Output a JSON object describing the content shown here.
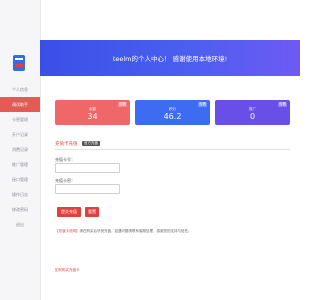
{
  "sidebar": {
    "items": [
      {
        "label": "个人信息",
        "active": false
      },
      {
        "label": "调试助手",
        "active": true
      },
      {
        "label": "卡密管理",
        "active": false
      },
      {
        "label": "开户记录",
        "active": false
      },
      {
        "label": "消费记录",
        "active": false
      },
      {
        "label": "推广管理",
        "active": false
      },
      {
        "label": "接口管理",
        "active": false
      },
      {
        "label": "操作日志",
        "active": false
      },
      {
        "label": "修改密码",
        "active": false
      },
      {
        "label": "退出",
        "active": false
      }
    ]
  },
  "banner": {
    "title": "teelm的个人中心！ 感谢使用本地环境!"
  },
  "cards": [
    {
      "badge": "查看",
      "label": "余额",
      "value": "34",
      "color": "#f0676a"
    },
    {
      "badge": "查看",
      "label": "积分",
      "value": "46.2",
      "color": "#3d6cf3"
    },
    {
      "badge": "查看",
      "label": "推广",
      "value": "0",
      "color": "#6a4ee8"
    }
  ],
  "section": {
    "title": "充值卡充值",
    "tag": "官方充值"
  },
  "form": {
    "field1_label": "充值卡号：",
    "field1_value": "",
    "field2_label": "充值卡密：",
    "field2_value": ""
  },
  "buttons": {
    "primary": "提交充值卡",
    "secondary": "重置"
  },
  "note": {
    "prefix": "【充值卡说明】",
    "text": "请在购买后尽快充值，如遇问题请联系客服处理，感谢您的支持与信任。"
  },
  "footer_link": "如何购买充值卡"
}
